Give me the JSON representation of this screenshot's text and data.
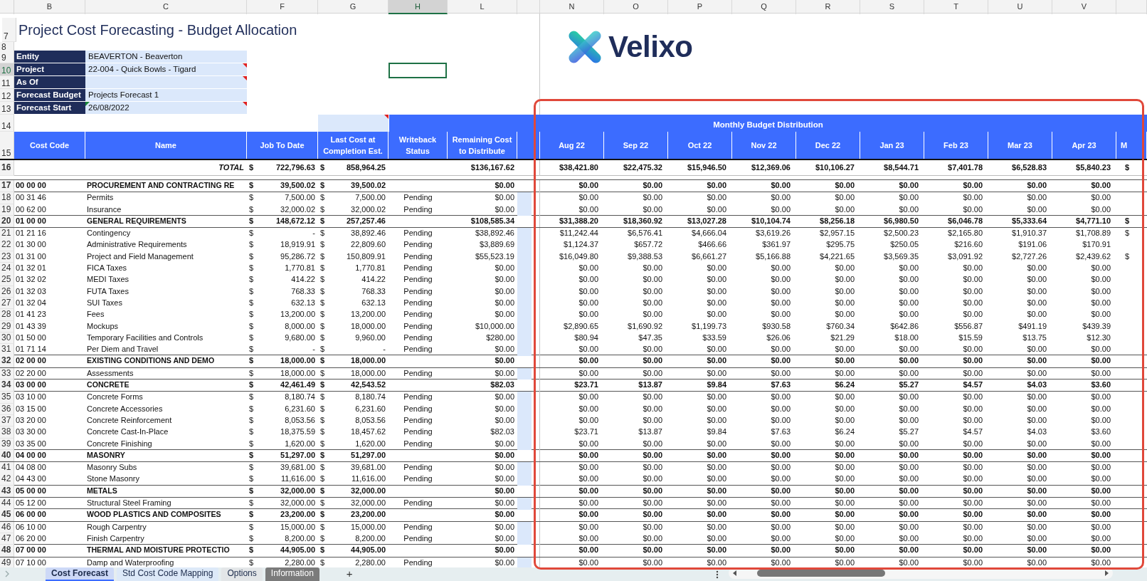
{
  "column_letters": [
    {
      "letter": "B",
      "selected": false
    },
    {
      "letter": "C",
      "selected": false
    },
    {
      "letter": "F",
      "selected": false
    },
    {
      "letter": "G",
      "selected": false
    },
    {
      "letter": "H",
      "selected": true
    },
    {
      "letter": "L",
      "selected": false
    },
    {
      "letter": "N",
      "selected": false
    },
    {
      "letter": "O",
      "selected": false
    },
    {
      "letter": "P",
      "selected": false
    },
    {
      "letter": "Q",
      "selected": false
    },
    {
      "letter": "R",
      "selected": false
    },
    {
      "letter": "S",
      "selected": false
    },
    {
      "letter": "T",
      "selected": false
    },
    {
      "letter": "U",
      "selected": false
    },
    {
      "letter": "V",
      "selected": false
    }
  ],
  "logo": {
    "text": "Velixo"
  },
  "top_rows": [
    {
      "num": "7",
      "kind": "title",
      "text": "Project Cost Forecasting - Budget Allocation",
      "selected": false
    },
    {
      "num": "8",
      "kind": "blank",
      "selected": false
    },
    {
      "num": "9",
      "kind": "info",
      "label": "Entity",
      "value": "BEAVERTON - Beaverton",
      "comment": false,
      "flag": false,
      "selected": false
    },
    {
      "num": "10",
      "kind": "info",
      "label": "Project",
      "value": "22-004 - Quick Bowls - Tigard",
      "comment": true,
      "flag": false,
      "selected": true
    },
    {
      "num": "11",
      "kind": "info",
      "label": "As Of",
      "comment": true,
      "flag": false,
      "selected": false
    },
    {
      "num": "12",
      "kind": "info",
      "label": "Forecast Budget",
      "value": "Projects Forecast 1",
      "comment": false,
      "flag": false,
      "selected": false
    },
    {
      "num": "13",
      "kind": "info",
      "label": "Forecast Start",
      "value": "26/08/2022",
      "comment": true,
      "flag": true,
      "selected": false
    }
  ],
  "band_row": {
    "num": "14",
    "title": "Monthly Budget Distribution",
    "comment": true
  },
  "header_row": {
    "num": "15",
    "columns": [
      "Cost Code",
      "Name",
      "Job To Date",
      "Last Cost at Completion Est.",
      "Writeback Status",
      "Remaining Cost to Distribute"
    ],
    "months": [
      "Aug 22",
      "Sep 22",
      "Oct 22",
      "Nov 22",
      "Dec 22",
      "Jan 23",
      "Feb 23",
      "Mar 23",
      "Apr 23"
    ],
    "month_cut": "M"
  },
  "total_row": {
    "num": "16",
    "label": "TOTAL",
    "jtd": [
      "$",
      "722,796.63"
    ],
    "lce": [
      "$",
      "858,964.25"
    ],
    "remaining": "$136,167.62",
    "months": [
      "$38,421.80",
      "$22,475.32",
      "$15,946.50",
      "$12,369.06",
      "$10,106.27",
      "$8,544.71",
      "$7,401.78",
      "$6,528.83",
      "$5,840.23"
    ],
    "month_cut": "$"
  },
  "rows": [
    {
      "num": "17",
      "kind": "group",
      "code": "00 00 00",
      "name": "PROCUREMENT AND CONTRACTING RE",
      "jtd": [
        "$",
        "39,500.02"
      ],
      "lce": [
        "$",
        "39,500.02"
      ],
      "remaining": "$0.00",
      "months": [
        "$0.00",
        "$0.00",
        "$0.00",
        "$0.00",
        "$0.00",
        "$0.00",
        "$0.00",
        "$0.00",
        "$0.00"
      ],
      "selected": false
    },
    {
      "num": "18",
      "kind": "item",
      "code": "00 31 46",
      "name": "Permits",
      "jtd": [
        "$",
        "7,500.00"
      ],
      "lce": [
        "$",
        "7,500.00"
      ],
      "status": "Pending",
      "remaining": "$0.00",
      "months": [
        "$0.00",
        "$0.00",
        "$0.00",
        "$0.00",
        "$0.00",
        "$0.00",
        "$0.00",
        "$0.00",
        "$0.00"
      ],
      "selected": false
    },
    {
      "num": "19",
      "kind": "item",
      "code": "00 62 00",
      "name": "Insurance",
      "jtd": [
        "$",
        "32,000.02"
      ],
      "lce": [
        "$",
        "32,000.02"
      ],
      "status": "Pending",
      "remaining": "$0.00",
      "months": [
        "$0.00",
        "$0.00",
        "$0.00",
        "$0.00",
        "$0.00",
        "$0.00",
        "$0.00",
        "$0.00",
        "$0.00"
      ],
      "selected": false
    },
    {
      "num": "20",
      "kind": "group",
      "code": "01 00 00",
      "name": "GENERAL REQUIREMENTS",
      "jtd": [
        "$",
        "148,672.12"
      ],
      "lce": [
        "$",
        "257,257.46"
      ],
      "remaining": "$108,585.34",
      "months": [
        "$31,388.20",
        "$18,360.92",
        "$13,027.28",
        "$10,104.74",
        "$8,256.18",
        "$6,980.50",
        "$6,046.78",
        "$5,333.64",
        "$4,771.10"
      ],
      "month_cut": "$",
      "selected": false
    },
    {
      "num": "21",
      "kind": "item",
      "code": "01 21 16",
      "name": "Contingency",
      "jtd": [
        "$",
        "-"
      ],
      "lce": [
        "$",
        "38,892.46"
      ],
      "status": "Pending",
      "remaining": "$38,892.46",
      "months": [
        "$11,242.44",
        "$6,576.41",
        "$4,666.04",
        "$3,619.26",
        "$2,957.15",
        "$2,500.23",
        "$2,165.80",
        "$1,910.37",
        "$1,708.89"
      ],
      "month_cut": "$",
      "selected": false
    },
    {
      "num": "22",
      "kind": "item",
      "code": "01 30 00",
      "name": "Administrative Requirements",
      "jtd": [
        "$",
        "18,919.91"
      ],
      "lce": [
        "$",
        "22,809.60"
      ],
      "status": "Pending",
      "remaining": "$3,889.69",
      "months": [
        "$1,124.37",
        "$657.72",
        "$466.66",
        "$361.97",
        "$295.75",
        "$250.05",
        "$216.60",
        "$191.06",
        "$170.91"
      ],
      "selected": false
    },
    {
      "num": "23",
      "kind": "item",
      "code": "01 31 00",
      "name": "Project and Field Management",
      "jtd": [
        "$",
        "95,286.72"
      ],
      "lce": [
        "$",
        "150,809.91"
      ],
      "status": "Pending",
      "remaining": "$55,523.19",
      "months": [
        "$16,049.80",
        "$9,388.53",
        "$6,661.27",
        "$5,166.88",
        "$4,221.65",
        "$3,569.35",
        "$3,091.92",
        "$2,727.26",
        "$2,439.62"
      ],
      "month_cut": "$",
      "selected": false
    },
    {
      "num": "24",
      "kind": "item",
      "code": "01 32 01",
      "name": "FICA Taxes",
      "jtd": [
        "$",
        "1,770.81"
      ],
      "lce": [
        "$",
        "1,770.81"
      ],
      "status": "Pending",
      "remaining": "$0.00",
      "months": [
        "$0.00",
        "$0.00",
        "$0.00",
        "$0.00",
        "$0.00",
        "$0.00",
        "$0.00",
        "$0.00",
        "$0.00"
      ],
      "selected": false
    },
    {
      "num": "25",
      "kind": "item",
      "code": "01 32 02",
      "name": "MEDI Taxes",
      "jtd": [
        "$",
        "414.22"
      ],
      "lce": [
        "$",
        "414.22"
      ],
      "status": "Pending",
      "remaining": "$0.00",
      "months": [
        "$0.00",
        "$0.00",
        "$0.00",
        "$0.00",
        "$0.00",
        "$0.00",
        "$0.00",
        "$0.00",
        "$0.00"
      ],
      "selected": false
    },
    {
      "num": "26",
      "kind": "item",
      "code": "01 32 03",
      "name": "FUTA Taxes",
      "jtd": [
        "$",
        "768.33"
      ],
      "lce": [
        "$",
        "768.33"
      ],
      "status": "Pending",
      "remaining": "$0.00",
      "months": [
        "$0.00",
        "$0.00",
        "$0.00",
        "$0.00",
        "$0.00",
        "$0.00",
        "$0.00",
        "$0.00",
        "$0.00"
      ],
      "selected": false
    },
    {
      "num": "27",
      "kind": "item",
      "code": "01 32 04",
      "name": "SUI Taxes",
      "jtd": [
        "$",
        "632.13"
      ],
      "lce": [
        "$",
        "632.13"
      ],
      "status": "Pending",
      "remaining": "$0.00",
      "months": [
        "$0.00",
        "$0.00",
        "$0.00",
        "$0.00",
        "$0.00",
        "$0.00",
        "$0.00",
        "$0.00",
        "$0.00"
      ],
      "selected": false
    },
    {
      "num": "28",
      "kind": "item",
      "code": "01 41 23",
      "name": "Fees",
      "jtd": [
        "$",
        "13,200.00"
      ],
      "lce": [
        "$",
        "13,200.00"
      ],
      "status": "Pending",
      "remaining": "$0.00",
      "months": [
        "$0.00",
        "$0.00",
        "$0.00",
        "$0.00",
        "$0.00",
        "$0.00",
        "$0.00",
        "$0.00",
        "$0.00"
      ],
      "selected": false
    },
    {
      "num": "29",
      "kind": "item",
      "code": "01 43 39",
      "name": "Mockups",
      "jtd": [
        "$",
        "8,000.00"
      ],
      "lce": [
        "$",
        "18,000.00"
      ],
      "status": "Pending",
      "remaining": "$10,000.00",
      "months": [
        "$2,890.65",
        "$1,690.92",
        "$1,199.73",
        "$930.58",
        "$760.34",
        "$642.86",
        "$556.87",
        "$491.19",
        "$439.39"
      ],
      "selected": false
    },
    {
      "num": "30",
      "kind": "item",
      "code": "01 50 00",
      "name": "Temporary Facilities and Controls",
      "jtd": [
        "$",
        "9,680.00"
      ],
      "lce": [
        "$",
        "9,960.00"
      ],
      "status": "Pending",
      "remaining": "$280.00",
      "months": [
        "$80.94",
        "$47.35",
        "$33.59",
        "$26.06",
        "$21.29",
        "$18.00",
        "$15.59",
        "$13.75",
        "$12.30"
      ],
      "selected": false
    },
    {
      "num": "31",
      "kind": "item",
      "code": "01 71 14",
      "name": "Per Diem and Travel",
      "jtd": [
        "$",
        "-"
      ],
      "lce": [
        "$",
        "-"
      ],
      "status": "Pending",
      "remaining": "$0.00",
      "months": [
        "$0.00",
        "$0.00",
        "$0.00",
        "$0.00",
        "$0.00",
        "$0.00",
        "$0.00",
        "$0.00",
        "$0.00"
      ],
      "selected": false
    },
    {
      "num": "32",
      "kind": "group",
      "code": "02 00 00",
      "name": "EXISTING CONDITIONS AND DEMO",
      "jtd": [
        "$",
        "18,000.00"
      ],
      "lce": [
        "$",
        "18,000.00"
      ],
      "remaining": "$0.00",
      "months": [
        "$0.00",
        "$0.00",
        "$0.00",
        "$0.00",
        "$0.00",
        "$0.00",
        "$0.00",
        "$0.00",
        "$0.00"
      ],
      "selected": false
    },
    {
      "num": "33",
      "kind": "item",
      "code": "02 20 00",
      "name": "Assessments",
      "jtd": [
        "$",
        "18,000.00"
      ],
      "lce": [
        "$",
        "18,000.00"
      ],
      "status": "Pending",
      "remaining": "$0.00",
      "months": [
        "$0.00",
        "$0.00",
        "$0.00",
        "$0.00",
        "$0.00",
        "$0.00",
        "$0.00",
        "$0.00",
        "$0.00"
      ],
      "selected": false
    },
    {
      "num": "34",
      "kind": "group",
      "code": "03 00 00",
      "name": "CONCRETE",
      "jtd": [
        "$",
        "42,461.49"
      ],
      "lce": [
        "$",
        "42,543.52"
      ],
      "remaining": "$82.03",
      "months": [
        "$23.71",
        "$13.87",
        "$9.84",
        "$7.63",
        "$6.24",
        "$5.27",
        "$4.57",
        "$4.03",
        "$3.60"
      ],
      "selected": false
    },
    {
      "num": "35",
      "kind": "item",
      "code": "03 10 00",
      "name": "Concrete Forms",
      "jtd": [
        "$",
        "8,180.74"
      ],
      "lce": [
        "$",
        "8,180.74"
      ],
      "status": "Pending",
      "remaining": "$0.00",
      "months": [
        "$0.00",
        "$0.00",
        "$0.00",
        "$0.00",
        "$0.00",
        "$0.00",
        "$0.00",
        "$0.00",
        "$0.00"
      ],
      "selected": false
    },
    {
      "num": "36",
      "kind": "item",
      "code": "03 15 00",
      "name": "Concrete Accessories",
      "jtd": [
        "$",
        "6,231.60"
      ],
      "lce": [
        "$",
        "6,231.60"
      ],
      "status": "Pending",
      "remaining": "$0.00",
      "months": [
        "$0.00",
        "$0.00",
        "$0.00",
        "$0.00",
        "$0.00",
        "$0.00",
        "$0.00",
        "$0.00",
        "$0.00"
      ],
      "selected": false
    },
    {
      "num": "37",
      "kind": "item",
      "code": "03 20 00",
      "name": "Concrete Reinforcement",
      "jtd": [
        "$",
        "8,053.56"
      ],
      "lce": [
        "$",
        "8,053.56"
      ],
      "status": "Pending",
      "remaining": "$0.00",
      "months": [
        "$0.00",
        "$0.00",
        "$0.00",
        "$0.00",
        "$0.00",
        "$0.00",
        "$0.00",
        "$0.00",
        "$0.00"
      ],
      "selected": false
    },
    {
      "num": "38",
      "kind": "item",
      "code": "03 30 00",
      "name": "Concrete Cast-In-Place",
      "jtd": [
        "$",
        "18,375.59"
      ],
      "lce": [
        "$",
        "18,457.62"
      ],
      "status": "Pending",
      "remaining": "$82.03",
      "months": [
        "$23.71",
        "$13.87",
        "$9.84",
        "$7.63",
        "$6.24",
        "$5.27",
        "$4.57",
        "$4.03",
        "$3.60"
      ],
      "selected": false
    },
    {
      "num": "39",
      "kind": "item",
      "code": "03 35 00",
      "name": "Concrete Finishing",
      "jtd": [
        "$",
        "1,620.00"
      ],
      "lce": [
        "$",
        "1,620.00"
      ],
      "status": "Pending",
      "remaining": "$0.00",
      "months": [
        "$0.00",
        "$0.00",
        "$0.00",
        "$0.00",
        "$0.00",
        "$0.00",
        "$0.00",
        "$0.00",
        "$0.00"
      ],
      "selected": false
    },
    {
      "num": "40",
      "kind": "group",
      "code": "04 00 00",
      "name": "MASONRY",
      "jtd": [
        "$",
        "51,297.00"
      ],
      "lce": [
        "$",
        "51,297.00"
      ],
      "remaining": "$0.00",
      "months": [
        "$0.00",
        "$0.00",
        "$0.00",
        "$0.00",
        "$0.00",
        "$0.00",
        "$0.00",
        "$0.00",
        "$0.00"
      ],
      "selected": false
    },
    {
      "num": "41",
      "kind": "item",
      "code": "04 08 00",
      "name": "Masonry Subs",
      "jtd": [
        "$",
        "39,681.00"
      ],
      "lce": [
        "$",
        "39,681.00"
      ],
      "status": "Pending",
      "remaining": "$0.00",
      "months": [
        "$0.00",
        "$0.00",
        "$0.00",
        "$0.00",
        "$0.00",
        "$0.00",
        "$0.00",
        "$0.00",
        "$0.00"
      ],
      "selected": false
    },
    {
      "num": "42",
      "kind": "item",
      "code": "04 43 00",
      "name": "Stone Masonry",
      "jtd": [
        "$",
        "11,616.00"
      ],
      "lce": [
        "$",
        "11,616.00"
      ],
      "status": "Pending",
      "remaining": "$0.00",
      "months": [
        "$0.00",
        "$0.00",
        "$0.00",
        "$0.00",
        "$0.00",
        "$0.00",
        "$0.00",
        "$0.00",
        "$0.00"
      ],
      "selected": false
    },
    {
      "num": "43",
      "kind": "group",
      "code": "05 00 00",
      "name": "METALS",
      "jtd": [
        "$",
        "32,000.00"
      ],
      "lce": [
        "$",
        "32,000.00"
      ],
      "remaining": "$0.00",
      "months": [
        "$0.00",
        "$0.00",
        "$0.00",
        "$0.00",
        "$0.00",
        "$0.00",
        "$0.00",
        "$0.00",
        "$0.00"
      ],
      "selected": false
    },
    {
      "num": "44",
      "kind": "item",
      "code": "05 12 00",
      "name": "Structural Steel Framing",
      "jtd": [
        "$",
        "32,000.00"
      ],
      "lce": [
        "$",
        "32,000.00"
      ],
      "status": "Pending",
      "remaining": "$0.00",
      "months": [
        "$0.00",
        "$0.00",
        "$0.00",
        "$0.00",
        "$0.00",
        "$0.00",
        "$0.00",
        "$0.00",
        "$0.00"
      ],
      "selected": false
    },
    {
      "num": "45",
      "kind": "group",
      "code": "06 00 00",
      "name": "WOOD PLASTICS AND COMPOSITES",
      "jtd": [
        "$",
        "23,200.00"
      ],
      "lce": [
        "$",
        "23,200.00"
      ],
      "remaining": "$0.00",
      "months": [
        "$0.00",
        "$0.00",
        "$0.00",
        "$0.00",
        "$0.00",
        "$0.00",
        "$0.00",
        "$0.00",
        "$0.00"
      ],
      "selected": false
    },
    {
      "num": "46",
      "kind": "item",
      "code": "06 10 00",
      "name": "Rough Carpentry",
      "jtd": [
        "$",
        "15,000.00"
      ],
      "lce": [
        "$",
        "15,000.00"
      ],
      "status": "Pending",
      "remaining": "$0.00",
      "months": [
        "$0.00",
        "$0.00",
        "$0.00",
        "$0.00",
        "$0.00",
        "$0.00",
        "$0.00",
        "$0.00",
        "$0.00"
      ],
      "selected": false
    },
    {
      "num": "47",
      "kind": "item",
      "code": "06 20 00",
      "name": "Finish Carpentry",
      "jtd": [
        "$",
        "8,200.00"
      ],
      "lce": [
        "$",
        "8,200.00"
      ],
      "status": "Pending",
      "remaining": "$0.00",
      "months": [
        "$0.00",
        "$0.00",
        "$0.00",
        "$0.00",
        "$0.00",
        "$0.00",
        "$0.00",
        "$0.00",
        "$0.00"
      ],
      "selected": false
    },
    {
      "num": "48",
      "kind": "group",
      "code": "07 00 00",
      "name": "THERMAL AND MOISTURE PROTECTIO",
      "jtd": [
        "$",
        "44,905.00"
      ],
      "lce": [
        "$",
        "44,905.00"
      ],
      "remaining": "$0.00",
      "months": [
        "$0.00",
        "$0.00",
        "$0.00",
        "$0.00",
        "$0.00",
        "$0.00",
        "$0.00",
        "$0.00",
        "$0.00"
      ],
      "selected": false
    },
    {
      "num": "49",
      "kind": "item",
      "code": "07 10 00",
      "name": "Damp and Waterproofing",
      "jtd": [
        "$",
        "2,280.00"
      ],
      "lce": [
        "$",
        "2,280.00"
      ],
      "status": "Pending",
      "remaining": "$0.00",
      "months": [
        "$0.00",
        "$0.00",
        "$0.00",
        "$0.00",
        "$0.00",
        "$0.00",
        "$0.00",
        "$0.00",
        "$0.00"
      ],
      "selected": false
    }
  ],
  "annotation": {
    "kind": "rectangle"
  },
  "sheet_tabs": [
    {
      "label": "Cost Forecast",
      "selected": true,
      "color": "#cdd9f7"
    },
    {
      "label": "Std Cost Code Mapping",
      "selected": false,
      "color": "#dde9f8"
    },
    {
      "label": "Options",
      "selected": false,
      "color": "#e3e6e8"
    },
    {
      "label": "Information",
      "selected": false,
      "color": "#7b7b7b"
    }
  ],
  "new_sheet": "+"
}
